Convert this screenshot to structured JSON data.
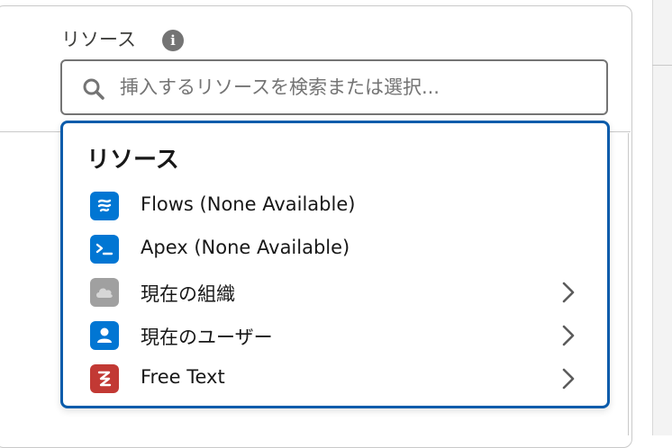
{
  "field": {
    "label": "リソース",
    "search_placeholder": "挿入するリソースを検索または選択..."
  },
  "dropdown": {
    "heading": "リソース",
    "items": [
      {
        "label": "Flows (None Available)",
        "icon": "flow-icon",
        "icon_color": "#0176d3",
        "has_submenu": false
      },
      {
        "label": "Apex (None Available)",
        "icon": "apex-icon",
        "icon_color": "#0176d3",
        "has_submenu": false
      },
      {
        "label": "現在の組織",
        "icon": "cloud-icon",
        "icon_color": "#a0a0a0",
        "has_submenu": true
      },
      {
        "label": "現在のユーザー",
        "icon": "user-icon",
        "icon_color": "#0176d3",
        "has_submenu": true
      },
      {
        "label": "Free Text",
        "icon": "text-icon",
        "icon_color": "#c23934",
        "has_submenu": true
      }
    ]
  },
  "colors": {
    "accent_border": "#0b5cab",
    "text": "#181818",
    "muted": "#747474"
  }
}
